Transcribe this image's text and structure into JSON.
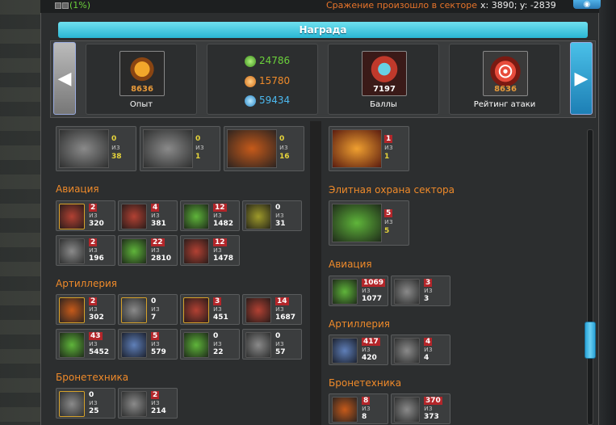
{
  "topbar": {
    "percent": "(1%)",
    "message": "Сражение произошло в секторе",
    "coords": "x: 3890; y: -2839",
    "eye_icon": "eye-icon"
  },
  "reward": {
    "title": "Награда",
    "experience": {
      "value": "8636",
      "label": "Опыт"
    },
    "resources": {
      "r1": "24786",
      "r2": "15780",
      "r3": "59434"
    },
    "score": {
      "value": "7197",
      "label": "Баллы"
    },
    "attack_rating": {
      "value": "8636",
      "label": "Рейтинг атаки"
    }
  },
  "left": {
    "top_units": [
      {
        "lost": "0",
        "of": "из",
        "total": "38"
      },
      {
        "lost": "0",
        "of": "из",
        "total": "1"
      },
      {
        "lost": "0",
        "of": "из",
        "total": "16"
      }
    ],
    "aviation": {
      "title": "Авиация",
      "units": [
        {
          "lost": "2",
          "of": "из",
          "total": "320"
        },
        {
          "lost": "4",
          "of": "из",
          "total": "381"
        },
        {
          "lost": "12",
          "of": "из",
          "total": "1482"
        },
        {
          "lost": "0",
          "of": "из",
          "total": "31"
        },
        {
          "lost": "2",
          "of": "из",
          "total": "196"
        },
        {
          "lost": "22",
          "of": "из",
          "total": "2810"
        },
        {
          "lost": "12",
          "of": "из",
          "total": "1478"
        }
      ]
    },
    "artillery": {
      "title": "Артиллерия",
      "units": [
        {
          "lost": "2",
          "of": "из",
          "total": "302"
        },
        {
          "lost": "0",
          "of": "из",
          "total": "7"
        },
        {
          "lost": "3",
          "of": "из",
          "total": "451"
        },
        {
          "lost": "14",
          "of": "из",
          "total": "1687"
        },
        {
          "lost": "43",
          "of": "из",
          "total": "5452"
        },
        {
          "lost": "5",
          "of": "из",
          "total": "579"
        },
        {
          "lost": "0",
          "of": "из",
          "total": "22"
        },
        {
          "lost": "0",
          "of": "из",
          "total": "57"
        }
      ]
    },
    "armor": {
      "title": "Бронетехника",
      "units": [
        {
          "lost": "0",
          "of": "из",
          "total": "25"
        },
        {
          "lost": "2",
          "of": "из",
          "total": "214"
        }
      ]
    }
  },
  "right": {
    "top_unit": {
      "lost": "1",
      "of": "из",
      "total": "1"
    },
    "elite_guard": {
      "title": "Элитная охрана сектора",
      "unit": {
        "lost": "5",
        "of": "из",
        "total": "5"
      }
    },
    "aviation": {
      "title": "Авиация",
      "units": [
        {
          "lost": "1069",
          "of": "из",
          "total": "1077"
        },
        {
          "lost": "3",
          "of": "из",
          "total": "3"
        }
      ]
    },
    "artillery": {
      "title": "Артиллерия",
      "units": [
        {
          "lost": "417",
          "of": "из",
          "total": "420"
        },
        {
          "lost": "4",
          "of": "из",
          "total": "4"
        }
      ]
    },
    "armor": {
      "title": "Бронетехника",
      "units": [
        {
          "lost": "8",
          "of": "из",
          "total": "8"
        },
        {
          "lost": "370",
          "of": "из",
          "total": "373"
        }
      ]
    }
  }
}
